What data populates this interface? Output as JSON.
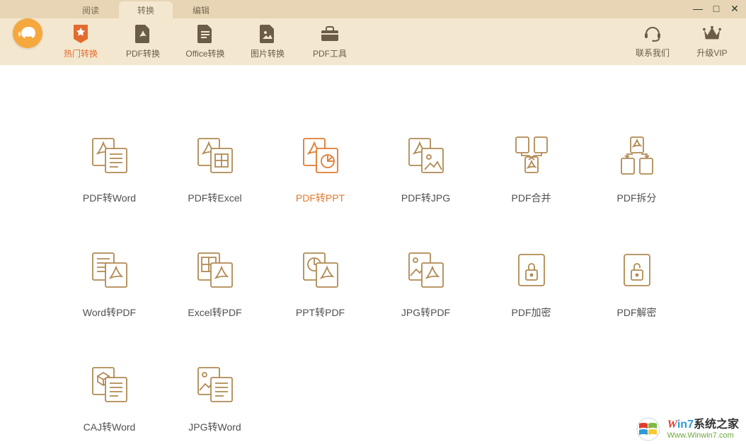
{
  "tabs": {
    "read": "阅读",
    "convert": "转换",
    "edit": "编辑"
  },
  "window": {
    "min": "—",
    "max": "□",
    "close": "✕"
  },
  "toolbar": {
    "hot": "热门转换",
    "pdf": "PDF转换",
    "office": "Office转换",
    "image": "图片转换",
    "tools": "PDF工具"
  },
  "right": {
    "contact": "联系我们",
    "vip": "升级VIP"
  },
  "conv": {
    "pdf2word": "PDF转Word",
    "pdf2excel": "PDF转Excel",
    "pdf2ppt": "PDF转PPT",
    "pdf2jpg": "PDF转JPG",
    "pdfmerge": "PDF合并",
    "pdfsplit": "PDF拆分",
    "word2pdf": "Word转PDF",
    "excel2pdf": "Excel转PDF",
    "ppt2pdf": "PPT转PDF",
    "jpg2pdf": "JPG转PDF",
    "pdfencrypt": "PDF加密",
    "pdfdecrypt": "PDF解密",
    "caj2word": "CAJ转Word",
    "jpg2word": "JPG转Word"
  },
  "watermark": {
    "line1_a": "in7",
    "line1_b": "系统之家",
    "line2": "Www.Winwin7.com"
  }
}
